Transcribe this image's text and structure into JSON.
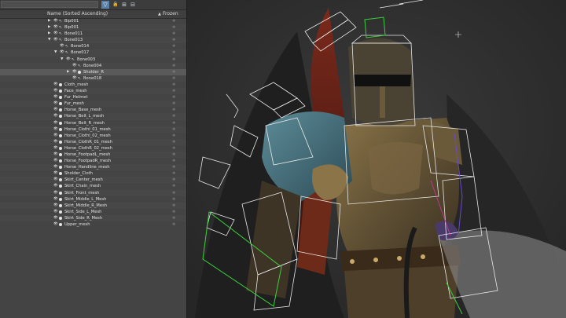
{
  "explorer": {
    "column_name": "Name (Sorted Ascending)",
    "sort_indicator": "▲",
    "column_frozen": "Frozen",
    "toolbar": {
      "select_icon": "▸",
      "highlight_icon": "▽",
      "lock_icon": "🔒",
      "hierarchy_icon": "⊞",
      "filter_icon": "⊟"
    },
    "rows": [
      {
        "label": "Bip001",
        "indent": 0,
        "arrow": "▶",
        "type": "bone"
      },
      {
        "label": "Bip001",
        "indent": 0,
        "arrow": "▶",
        "type": "bone"
      },
      {
        "label": "Bone011",
        "indent": 0,
        "arrow": "▶",
        "type": "bone"
      },
      {
        "label": "Bone013",
        "indent": 0,
        "arrow": "▼",
        "type": "bone"
      },
      {
        "label": "Bone014",
        "indent": 1,
        "arrow": "",
        "type": "bone"
      },
      {
        "label": "Bone017",
        "indent": 1,
        "arrow": "▼",
        "type": "bone"
      },
      {
        "label": "Bone003",
        "indent": 2,
        "arrow": "▼",
        "type": "bone"
      },
      {
        "label": "Bone004",
        "indent": 3,
        "arrow": "",
        "type": "bone"
      },
      {
        "label": "Sholder_R",
        "indent": 3,
        "arrow": "▶",
        "type": "mesh",
        "selected": true
      },
      {
        "label": "Bone018",
        "indent": 3,
        "arrow": "",
        "type": "bone"
      },
      {
        "label": "Cloth_mesh",
        "indent": 0,
        "arrow": "",
        "type": "mesh"
      },
      {
        "label": "Face_mesh",
        "indent": 0,
        "arrow": "",
        "type": "mesh"
      },
      {
        "label": "Fur_Helmet",
        "indent": 0,
        "arrow": "",
        "type": "mesh"
      },
      {
        "label": "Fur_mesh",
        "indent": 0,
        "arrow": "",
        "type": "mesh"
      },
      {
        "label": "Horse_Base_mesh",
        "indent": 0,
        "arrow": "",
        "type": "mesh"
      },
      {
        "label": "Horse_Belt_L_mesh",
        "indent": 0,
        "arrow": "",
        "type": "mesh"
      },
      {
        "label": "Horse_Belt_R_mesh",
        "indent": 0,
        "arrow": "",
        "type": "mesh"
      },
      {
        "label": "Horse_Clothl_01_mesh",
        "indent": 0,
        "arrow": "",
        "type": "mesh"
      },
      {
        "label": "Horse_Clothl_02_mesh",
        "indent": 0,
        "arrow": "",
        "type": "mesh"
      },
      {
        "label": "Horse_ClothR_01_mesh",
        "indent": 0,
        "arrow": "",
        "type": "mesh"
      },
      {
        "label": "Horse_ClothR_02_mesh",
        "indent": 0,
        "arrow": "",
        "type": "mesh"
      },
      {
        "label": "Horse_FootpadL_mesh",
        "indent": 0,
        "arrow": "",
        "type": "mesh"
      },
      {
        "label": "Horse_FootpadR_mesh",
        "indent": 0,
        "arrow": "",
        "type": "mesh"
      },
      {
        "label": "Horse_Handline_mesh",
        "indent": 0,
        "arrow": "",
        "type": "mesh"
      },
      {
        "label": "Sholder_Cloth",
        "indent": 0,
        "arrow": "",
        "type": "mesh"
      },
      {
        "label": "Skirt_Center_mesh",
        "indent": 0,
        "arrow": "",
        "type": "mesh"
      },
      {
        "label": "Skirt_Chain_mesh",
        "indent": 0,
        "arrow": "",
        "type": "mesh"
      },
      {
        "label": "Skirt_Front_mesh",
        "indent": 0,
        "arrow": "",
        "type": "mesh"
      },
      {
        "label": "Skirt_Middle_L_Mesh",
        "indent": 0,
        "arrow": "",
        "type": "mesh"
      },
      {
        "label": "Skirt_Middle_R_Mesh",
        "indent": 0,
        "arrow": "",
        "type": "mesh"
      },
      {
        "label": "Skirt_Side_L_Mesh",
        "indent": 0,
        "arrow": "",
        "type": "mesh"
      },
      {
        "label": "Skirt_Side_R_Mesh",
        "indent": 0,
        "arrow": "",
        "type": "mesh"
      },
      {
        "label": "Upper_mesh",
        "indent": 0,
        "arrow": "",
        "type": "mesh"
      }
    ],
    "frozen_icon": "❄"
  },
  "viewport": {
    "colors": {
      "background": "#2e2e2e",
      "armor": "#6b5a3a",
      "pauldron": "#3f6a78",
      "cape": "#6a1f16",
      "wireframe": "#e8e8e8",
      "selection": "#3ad23a"
    }
  }
}
